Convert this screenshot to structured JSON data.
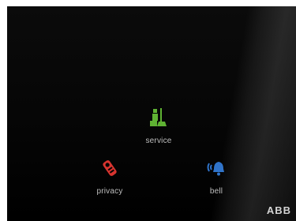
{
  "device": {
    "brand_logo": "ABB"
  },
  "buttons": [
    {
      "label": "service",
      "icon": "service-icon",
      "color": "#5fb233"
    },
    {
      "label": "privacy",
      "icon": "do-not-disturb-tag-icon",
      "color": "#d8342f"
    },
    {
      "label": "bell",
      "icon": "bell-icon",
      "color": "#2f73c9"
    }
  ]
}
